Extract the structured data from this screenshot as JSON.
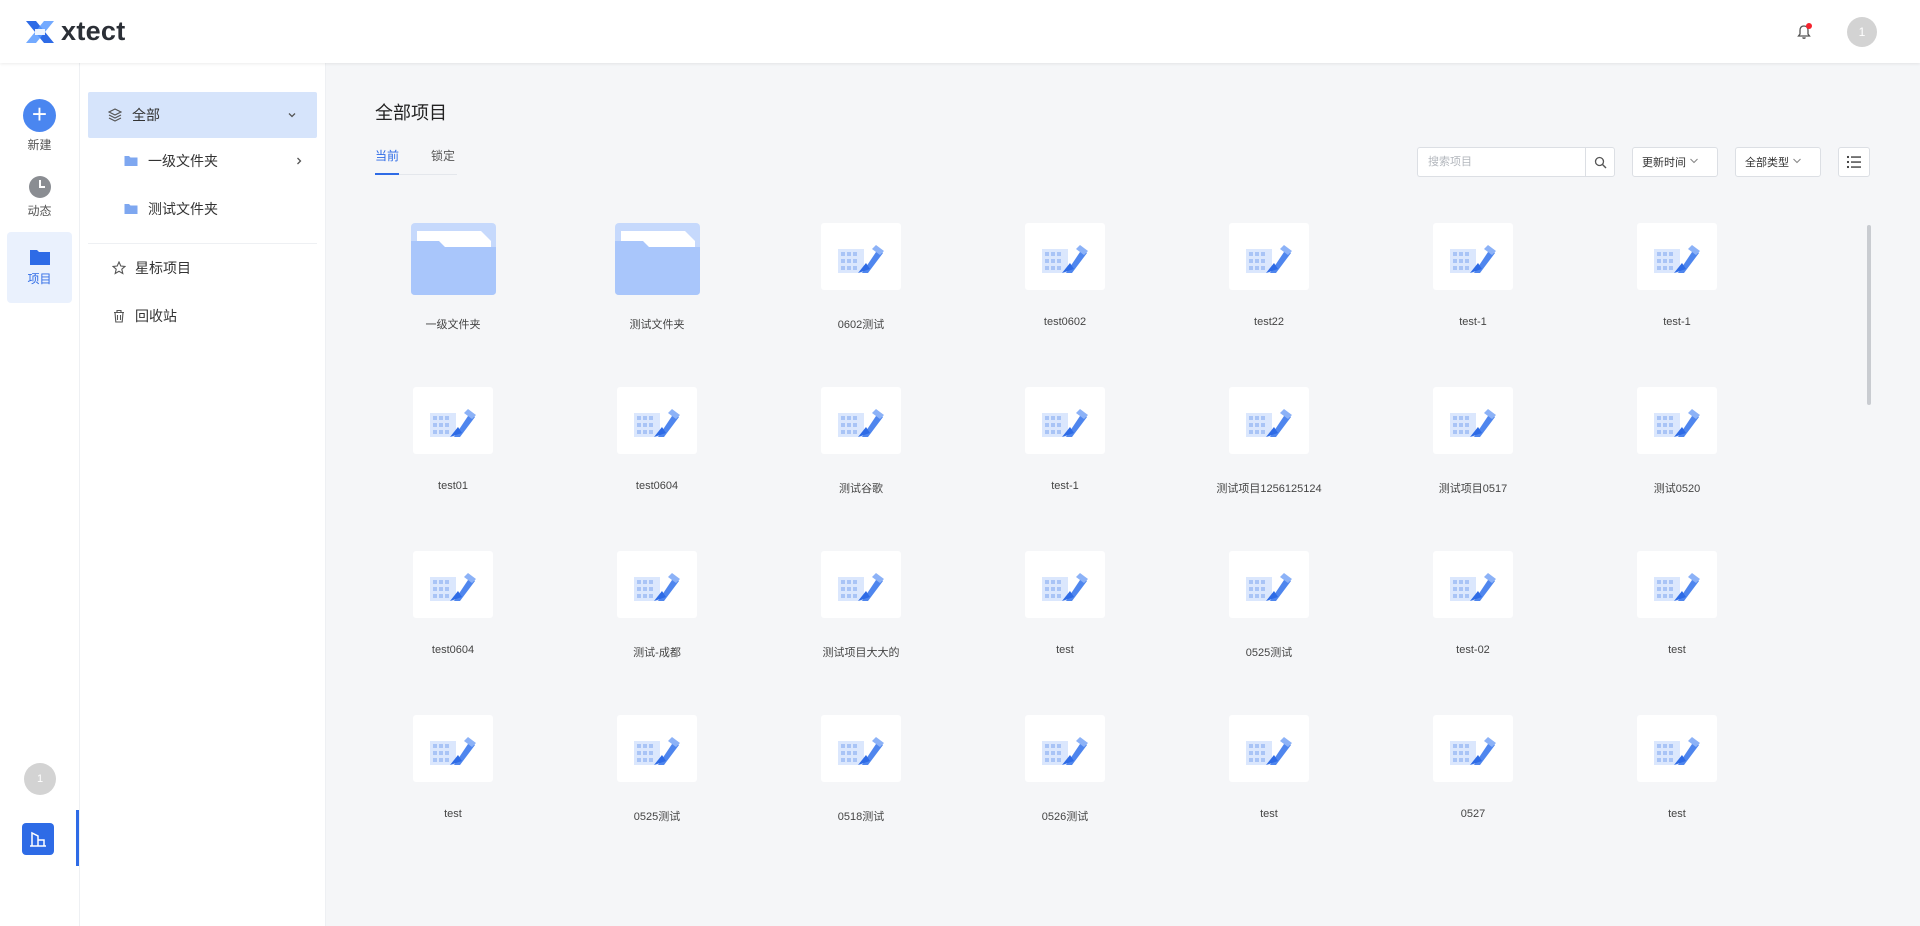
{
  "header": {
    "app_name": "xtect",
    "avatar_text": "1"
  },
  "rail": {
    "new_label": "新建",
    "activity_label": "动态",
    "project_label": "项目",
    "avatar_text": "1"
  },
  "sidebar": {
    "all_label": "全部",
    "subfolders": [
      "一级文件夹",
      "测试文件夹"
    ],
    "starred_label": "星标项目",
    "trash_label": "回收站"
  },
  "main": {
    "title": "全部项目",
    "tabs": [
      "当前",
      "锁定"
    ],
    "active_tab": "当前",
    "search_placeholder": "搜索项目",
    "sort_label": "更新时间",
    "type_label": "全部类型"
  },
  "items": [
    {
      "name": "一级文件夹",
      "kind": "folder"
    },
    {
      "name": "测试文件夹",
      "kind": "folder"
    },
    {
      "name": "0602测试",
      "kind": "project"
    },
    {
      "name": "test0602",
      "kind": "project"
    },
    {
      "name": "test22",
      "kind": "project"
    },
    {
      "name": "test-1",
      "kind": "project"
    },
    {
      "name": "test-1",
      "kind": "project"
    },
    {
      "name": "test01",
      "kind": "project"
    },
    {
      "name": "test0604",
      "kind": "project"
    },
    {
      "name": "测试谷歌",
      "kind": "project"
    },
    {
      "name": "test-1",
      "kind": "project"
    },
    {
      "name": "测试项目1256125124",
      "kind": "project"
    },
    {
      "name": "测试项目0517",
      "kind": "project"
    },
    {
      "name": "测试0520",
      "kind": "project"
    },
    {
      "name": "test0604",
      "kind": "project"
    },
    {
      "name": "测试-成都",
      "kind": "project"
    },
    {
      "name": "测试项目大大的",
      "kind": "project"
    },
    {
      "name": "test",
      "kind": "project"
    },
    {
      "name": "0525测试",
      "kind": "project"
    },
    {
      "name": "test-02",
      "kind": "project"
    },
    {
      "name": "test",
      "kind": "project"
    },
    {
      "name": "test",
      "kind": "project"
    },
    {
      "name": "0525测试",
      "kind": "project"
    },
    {
      "name": "0518测试",
      "kind": "project"
    },
    {
      "name": "0526测试",
      "kind": "project"
    },
    {
      "name": "test",
      "kind": "project"
    },
    {
      "name": "0527",
      "kind": "project"
    },
    {
      "name": "test",
      "kind": "project"
    }
  ],
  "colors": {
    "accent": "#2e6be6",
    "accent_light": "#d6e4fb",
    "folder": "#a9c6fb"
  }
}
